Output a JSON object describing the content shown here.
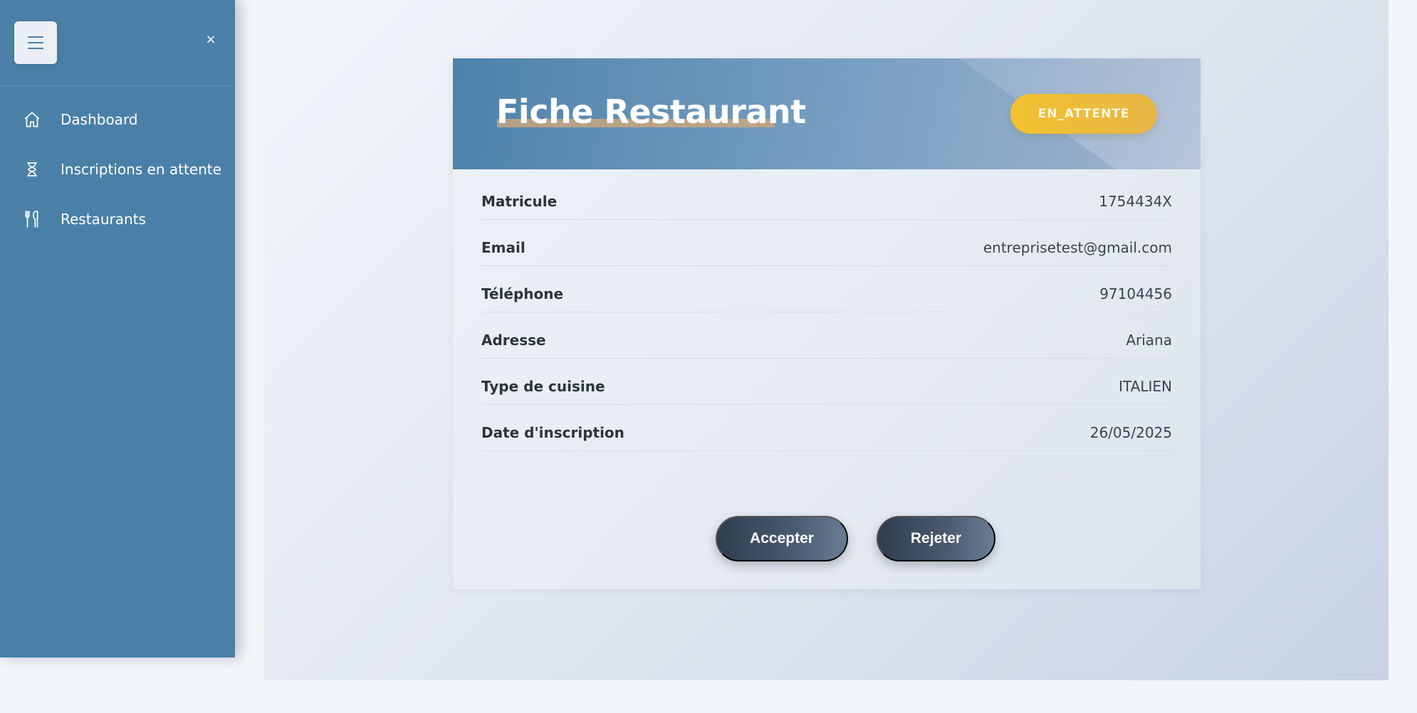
{
  "sidebar": {
    "toggle_icon": "hamburger-menu-icon",
    "close_label": "×",
    "items": [
      {
        "icon": "home-icon",
        "label": "Dashboard"
      },
      {
        "icon": "hourglass-icon",
        "label": "Inscriptions en attente"
      },
      {
        "icon": "fork-knife-icon",
        "label": "Restaurants"
      }
    ]
  },
  "card": {
    "title": "Fiche Restaurant",
    "status": "EN_ATTENTE",
    "fields": [
      {
        "label": "Matricule",
        "value": "1754434X"
      },
      {
        "label": "Email",
        "value": "entreprisetest@gmail.com"
      },
      {
        "label": "Téléphone",
        "value": "97104456"
      },
      {
        "label": "Adresse",
        "value": "Ariana"
      },
      {
        "label": "Type de cuisine",
        "value": "ITALIEN"
      },
      {
        "label": "Date d'inscription",
        "value": "26/05/2025"
      }
    ],
    "actions": {
      "accept_label": "Accepter",
      "reject_label": "Rejeter"
    }
  },
  "colors": {
    "sidebar_bg": "#4a80a8",
    "status_badge": "#f1c22e",
    "button_dark": "#2f3d4e"
  }
}
